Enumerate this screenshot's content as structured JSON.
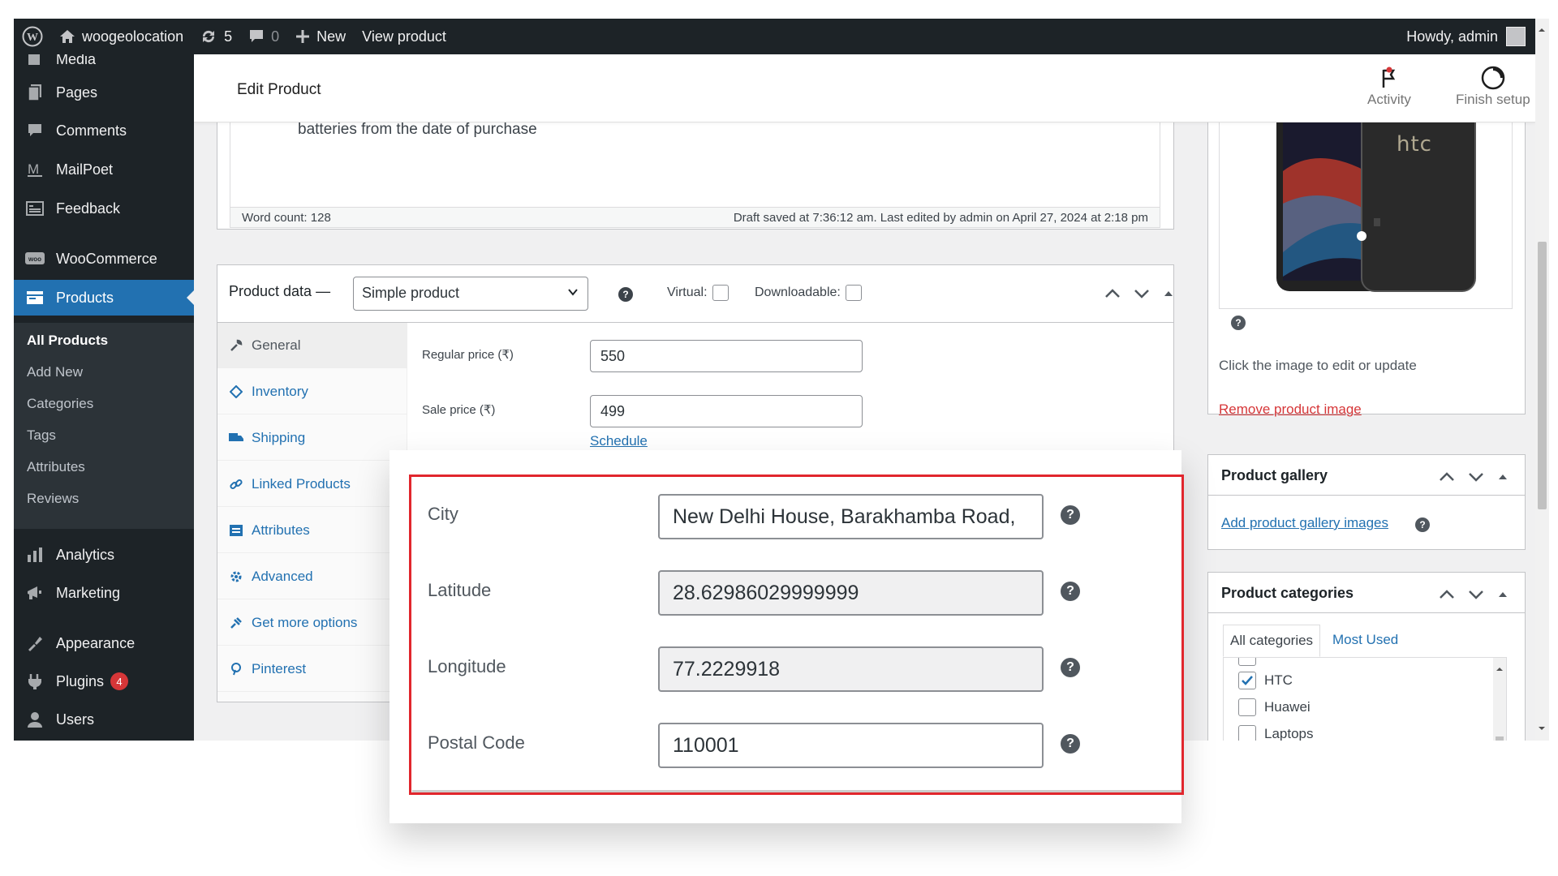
{
  "adminbar": {
    "site_name": "woogeolocation",
    "updates_count": "5",
    "comments_count": "0",
    "new_label": "New",
    "view_product": "View product",
    "howdy": "Howdy, admin"
  },
  "sidebar": {
    "items": [
      {
        "label": "Media",
        "icon": "media-icon"
      },
      {
        "label": "Pages",
        "icon": "pages-icon"
      },
      {
        "label": "Comments",
        "icon": "comments-icon"
      },
      {
        "label": "MailPoet",
        "icon": "mailpoet-icon"
      },
      {
        "label": "Feedback",
        "icon": "feedback-icon"
      },
      {
        "label": "WooCommerce",
        "icon": "woocommerce-icon"
      },
      {
        "label": "Products",
        "icon": "products-icon"
      },
      {
        "label": "Analytics",
        "icon": "analytics-icon"
      },
      {
        "label": "Marketing",
        "icon": "marketing-icon"
      },
      {
        "label": "Appearance",
        "icon": "appearance-icon"
      },
      {
        "label": "Plugins",
        "icon": "plugins-icon",
        "badge": "4"
      },
      {
        "label": "Users",
        "icon": "users-icon"
      }
    ],
    "submenu": [
      "All Products",
      "Add New",
      "Categories",
      "Tags",
      "Attributes",
      "Reviews"
    ]
  },
  "header": {
    "title": "Edit Product",
    "activity": "Activity",
    "finish_setup": "Finish setup"
  },
  "editor": {
    "text": "batteries from the date of purchase",
    "word_count": "Word count: 128",
    "draft_status": "Draft saved at 7:36:12 am. Last edited by admin on April 27, 2024 at 2:18 pm"
  },
  "product_data": {
    "title": "Product data —",
    "type": "Simple product",
    "virtual": "Virtual:",
    "downloadable": "Downloadable:",
    "tabs": [
      "General",
      "Inventory",
      "Shipping",
      "Linked Products",
      "Attributes",
      "Advanced",
      "Get more options",
      "Pinterest"
    ],
    "regular_price_label": "Regular price (₹)",
    "regular_price": "550",
    "sale_price_label": "Sale price (₹)",
    "sale_price": "499",
    "schedule": "Schedule"
  },
  "geo": {
    "city_label": "City",
    "city": "New Delhi House, Barakhamba Road,",
    "latitude_label": "Latitude",
    "latitude": "28.62986029999999",
    "longitude_label": "Longitude",
    "longitude": "77.2229918",
    "postal_label": "Postal Code",
    "postal": "110001"
  },
  "product_image": {
    "brand": "htc",
    "hint": "Click the image to edit or update",
    "remove": "Remove product image"
  },
  "gallery": {
    "title": "Product gallery",
    "add": "Add product gallery images"
  },
  "categories": {
    "title": "Product categories",
    "tab_all": "All categories",
    "tab_used": "Most Used",
    "items": [
      {
        "label": "HTC",
        "checked": true
      },
      {
        "label": "Huawei",
        "checked": false
      },
      {
        "label": "Laptops",
        "checked": false
      }
    ]
  },
  "colors": {
    "accent": "#2271b1",
    "admin_dark": "#1d2327",
    "highlight_border": "#e1262d",
    "badge": "#d63638"
  }
}
